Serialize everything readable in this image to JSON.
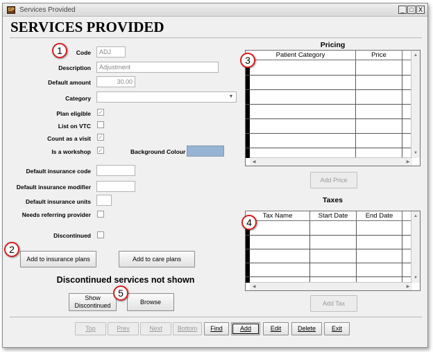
{
  "window": {
    "title": "Services Provided",
    "app_icon_letters": "SP",
    "controls": {
      "minimize": "_",
      "maximize": "□",
      "close": "X"
    }
  },
  "page_title": "SERVICES PROVIDED",
  "callouts": [
    "1",
    "2",
    "3",
    "4",
    "5"
  ],
  "form": {
    "code": {
      "label": "Code",
      "value": "ADJ"
    },
    "description": {
      "label": "Description",
      "value": "Adjustment"
    },
    "default_amount": {
      "label": "Default amount",
      "value": "30.00"
    },
    "category": {
      "label": "Category",
      "value": ""
    },
    "plan_eligible": {
      "label": "Plan eligible",
      "checked": true
    },
    "list_on_vtc": {
      "label": "List on VTC",
      "checked": false
    },
    "count_as_visit": {
      "label": "Count as a visit",
      "checked": true
    },
    "is_workshop": {
      "label": "Is a workshop",
      "checked": true
    },
    "background_colour": {
      "label": "Background Colour",
      "color": "#98b4d4"
    },
    "default_insurance_code": {
      "label": "Default insurance code",
      "value": ""
    },
    "default_insurance_modifier": {
      "label": "Default insurance modifier",
      "value": ""
    },
    "default_insurance_units": {
      "label": "Default insurance units",
      "value": ""
    },
    "needs_referring_provider": {
      "label": "Needs referring provider",
      "checked": false
    },
    "discontinued": {
      "label": "Discontinued",
      "checked": false
    }
  },
  "buttons": {
    "add_to_insurance_plans": "Add to insurance plans",
    "add_to_care_plans": "Add to care plans",
    "show_discontinued": "Show Discontinued",
    "browse": "Browse",
    "add_price": "Add Price",
    "add_tax": "Add Tax"
  },
  "notice": "Discontinued services not shown",
  "pricing": {
    "title": "Pricing",
    "columns": [
      "Patient Category",
      "Price"
    ]
  },
  "taxes": {
    "title": "Taxes",
    "columns": [
      "Tax Name",
      "Start Date",
      "End Date"
    ]
  },
  "nav": {
    "top": "Top",
    "prev": "Prev",
    "next": "Next",
    "bottom": "Bottom",
    "find": "Find",
    "add": "Add",
    "edit": "Edit",
    "delete": "Delete",
    "exit": "Exit"
  },
  "colors": {
    "callout_border": "#d21f1f",
    "swatch": "#98b4d4"
  }
}
